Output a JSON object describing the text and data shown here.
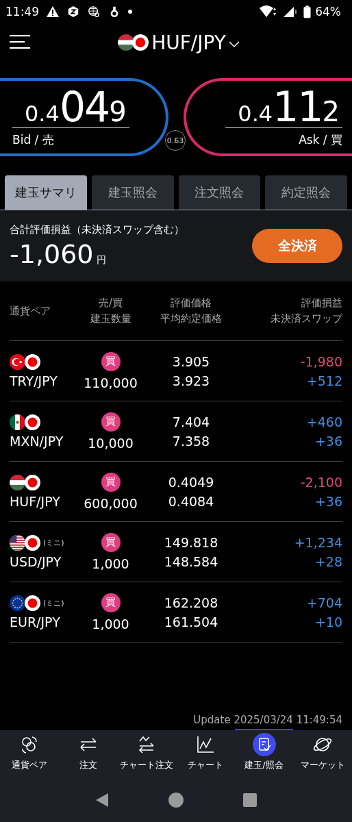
{
  "status_bar": {
    "time": "11:49",
    "battery": "64%"
  },
  "header": {
    "pair": "HUF/JPY"
  },
  "quotes": [
    {
      "kind": "bid",
      "prefix": "0.4",
      "big": "04",
      "suffix": "9",
      "label": "Bid / 売"
    },
    {
      "kind": "ask",
      "prefix": "0.4",
      "big": "11",
      "suffix": "2",
      "label": "Ask / 買"
    }
  ],
  "spread": "0.63",
  "tabs": [
    {
      "label": "建玉サマリ",
      "selected": true
    },
    {
      "label": "建玉照会",
      "selected": false
    },
    {
      "label": "注文照会",
      "selected": false
    },
    {
      "label": "約定照会",
      "selected": false
    }
  ],
  "summary": {
    "label": "合計評価損益（未決済スワップ含む）",
    "value": "-1,060",
    "unit": "円",
    "button": "全決済"
  },
  "table": {
    "columns": [
      [
        "通貨ペア"
      ],
      [
        "売/買",
        "建玉数量"
      ],
      [
        "評価価格",
        "平均約定価格"
      ],
      [
        "評価損益",
        "未決済スワップ"
      ]
    ],
    "rows": [
      {
        "kind": "tr",
        "pair": "TRY/JPY",
        "side": "買",
        "quantity": "110,000",
        "price": "3.905",
        "avg_price": "3.923",
        "pnl": "-1,980",
        "pnl_positive": false,
        "swap": "+512",
        "swap_positive": true
      },
      {
        "kind": "mx",
        "pair": "MXN/JPY",
        "side": "買",
        "quantity": "10,000",
        "price": "7.404",
        "avg_price": "7.358",
        "pnl": "+460",
        "pnl_positive": true,
        "swap": "+36",
        "swap_positive": true
      },
      {
        "kind": "hu",
        "pair": "HUF/JPY",
        "side": "買",
        "quantity": "600,000",
        "price": "0.4049",
        "avg_price": "0.4084",
        "pnl": "-2,100",
        "pnl_positive": false,
        "swap": "+36",
        "swap_positive": true
      },
      {
        "kind": "us",
        "mini": "(ミニ)",
        "pair": "USD/JPY",
        "side": "買",
        "quantity": "1,000",
        "price": "149.818",
        "avg_price": "148.584",
        "pnl": "+1,234",
        "pnl_positive": true,
        "swap": "+28",
        "swap_positive": true
      },
      {
        "kind": "eu",
        "mini": "(ミニ)",
        "pair": "EUR/JPY",
        "side": "買",
        "quantity": "1,000",
        "price": "162.208",
        "avg_price": "161.504",
        "pnl": "+704",
        "pnl_positive": true,
        "swap": "+10",
        "swap_positive": true
      }
    ]
  },
  "update": "Update 2025/03/24 11:49:54",
  "bottom_nav": [
    {
      "kind": "pairs",
      "label": "通貨ペア",
      "selected": false
    },
    {
      "kind": "order",
      "label": "注文",
      "selected": false
    },
    {
      "kind": "chart-order",
      "label": "チャート注文",
      "selected": false
    },
    {
      "kind": "chart",
      "label": "チャート",
      "selected": false
    },
    {
      "kind": "positions",
      "label": "建玉/照会",
      "selected": true
    },
    {
      "kind": "market",
      "label": "マーケット",
      "selected": false
    }
  ]
}
